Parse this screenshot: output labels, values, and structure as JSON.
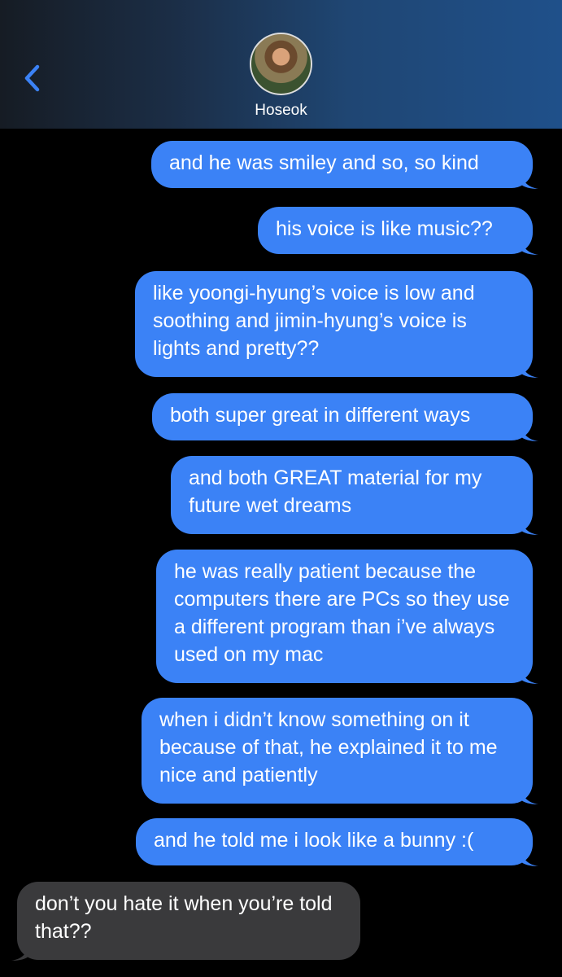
{
  "header": {
    "contact_name": "Hoseok",
    "back_icon": "chevron-left-icon",
    "accent_color": "#3b82f6"
  },
  "messages": [
    {
      "direction": "outgoing",
      "text": "and he was smiley and so, so kind"
    },
    {
      "direction": "outgoing",
      "text": "his voice is like music??"
    },
    {
      "direction": "outgoing",
      "text": "like yoongi-hyung’s voice is low and soothing and jimin-hyung’s voice is lights and pretty??"
    },
    {
      "direction": "outgoing",
      "text": "both super great in different ways"
    },
    {
      "direction": "outgoing",
      "text": "and both GREAT material for my future wet dreams"
    },
    {
      "direction": "outgoing",
      "text": "he was really patient because the computers there are PCs so they use a different program than i’ve always used on my mac"
    },
    {
      "direction": "outgoing",
      "text": "when i didn’t know something on it because of that, he explained it to me nice and patiently"
    },
    {
      "direction": "outgoing",
      "text": "and he told me i look like a bunny :("
    },
    {
      "direction": "incoming",
      "text": "don’t you hate it when you’re told that??"
    }
  ],
  "colors": {
    "outgoing_bubble": "#3b82f6",
    "incoming_bubble": "#3a3a3c",
    "background": "#000000"
  }
}
